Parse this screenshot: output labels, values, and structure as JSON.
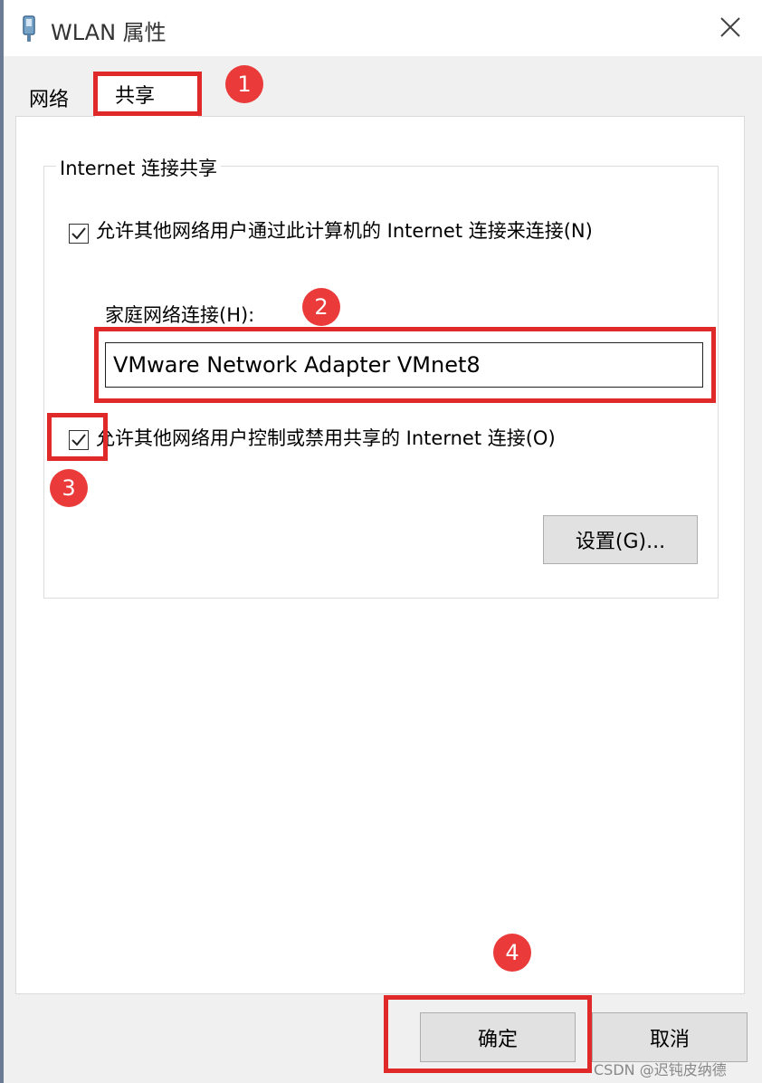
{
  "window": {
    "title": "WLAN 属性",
    "icon": "network-adapter-icon",
    "close_icon": "close-icon"
  },
  "tabs": [
    {
      "label": "网络",
      "selected": false
    },
    {
      "label": "共享",
      "selected": true
    }
  ],
  "sharing": {
    "group_title": "Internet 连接共享",
    "allow_sharing": {
      "label": "允许其他网络用户通过此计算机的 Internet 连接来连接(N)",
      "checked": true
    },
    "home_connection_label": "家庭网络连接(H):",
    "home_connection_value": "VMware Network Adapter VMnet8",
    "allow_control": {
      "label": "允许其他网络用户控制或禁用共享的 Internet 连接(O)",
      "checked": true
    },
    "settings_button": "设置(G)..."
  },
  "footer": {
    "ok_button": "确定",
    "cancel_button": "取消"
  },
  "annotations": {
    "badges": [
      "1",
      "2",
      "3",
      "4"
    ],
    "highlight_color": "#e02a2a"
  },
  "watermark": "CSDN @迟钝皮纳德"
}
